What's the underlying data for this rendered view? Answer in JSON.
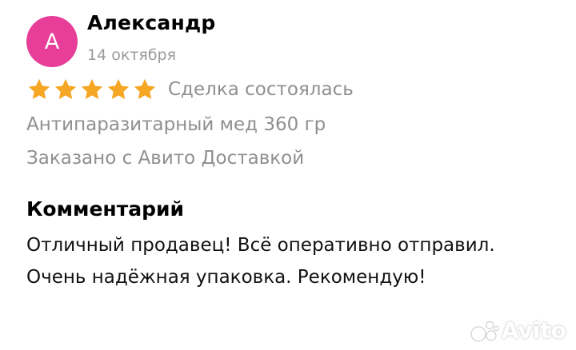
{
  "review": {
    "avatar_letter": "А",
    "avatar_color": "#e83e9a",
    "author": "Александр",
    "date": "14 октября",
    "rating": 5,
    "rating_max": 5,
    "star_color": "#f5a623",
    "deal_status": "Сделка состоялась",
    "product": "Антипаразитарный мед 360 гр",
    "delivery": "Заказано с Авито Доставкой",
    "comment_heading": "Комментарий",
    "comment_text": "Отличный продавец! Всё оперативно отправил. Очень надёжная упаковка. Рекомендую!"
  },
  "watermark": {
    "text": "Avito",
    "icon": "avito-logo-icon"
  }
}
